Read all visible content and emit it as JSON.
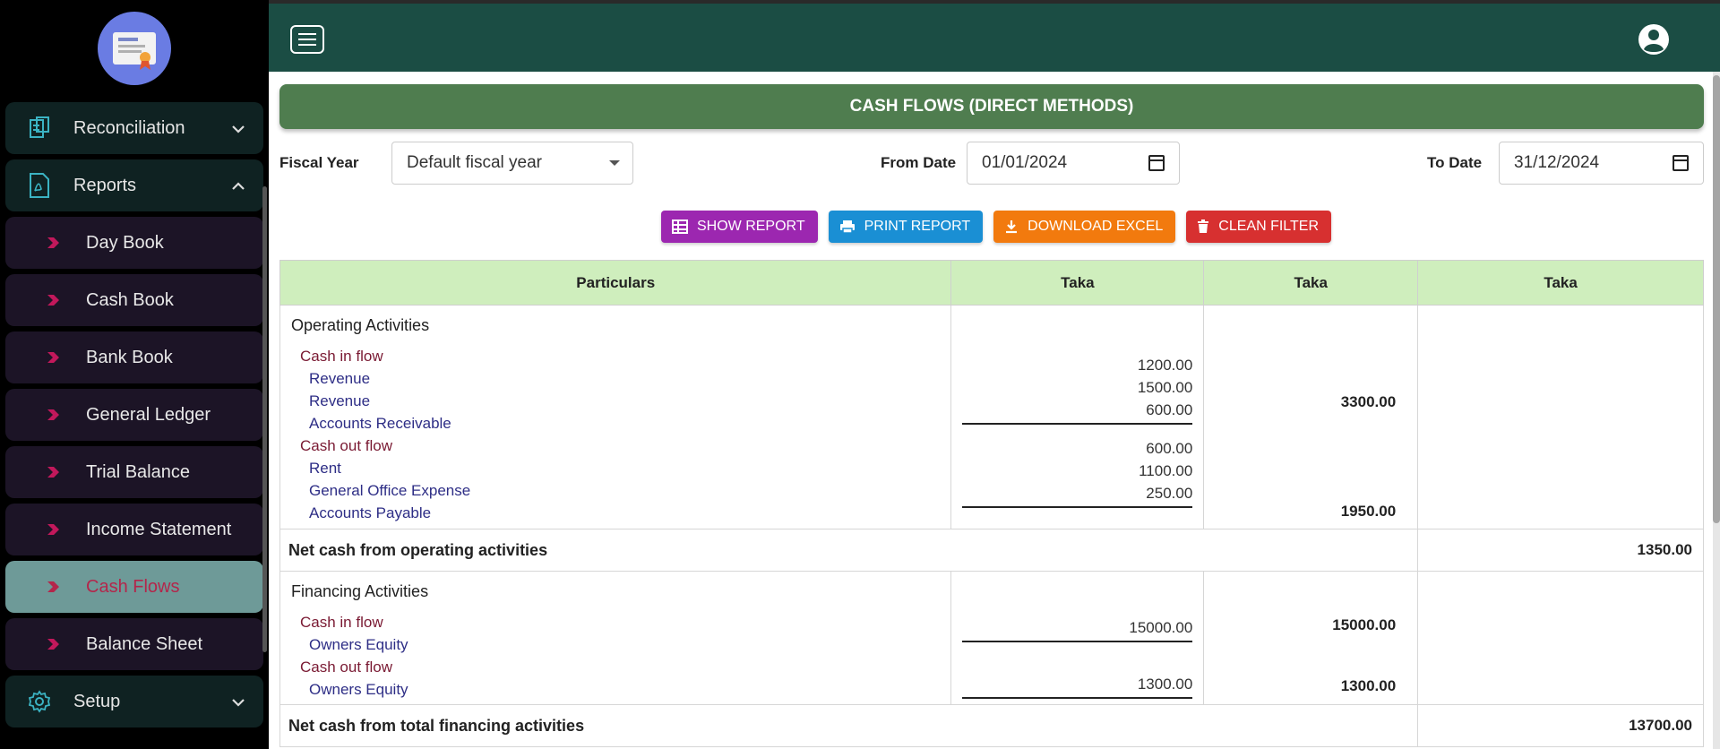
{
  "sidebar": {
    "groups": [
      {
        "label": "Reconciliation",
        "icon": "reconciliation-icon",
        "expanded": false
      },
      {
        "label": "Reports",
        "icon": "pdf-report-icon",
        "expanded": true
      },
      {
        "label": "Setup",
        "icon": "gear-icon",
        "expanded": false
      }
    ],
    "report_items": [
      {
        "label": "Day Book"
      },
      {
        "label": "Cash Book"
      },
      {
        "label": "Bank Book"
      },
      {
        "label": "General Ledger"
      },
      {
        "label": "Trial Balance"
      },
      {
        "label": "Income Statement"
      },
      {
        "label": "Cash Flows",
        "active": true
      },
      {
        "label": "Balance Sheet"
      }
    ]
  },
  "page": {
    "title": "CASH FLOWS (DIRECT METHODS)"
  },
  "filters": {
    "fiscal_year_label": "Fiscal Year",
    "fiscal_year_value": "Default fiscal year",
    "from_date_label": "From Date",
    "from_date_value": "01/01/2024",
    "to_date_label": "To Date",
    "to_date_value": "31/12/2024"
  },
  "buttons": {
    "show_report": "SHOW REPORT",
    "print_report": "PRINT REPORT",
    "download_excel": "DOWNLOAD EXCEL",
    "clean_filter": "CLEAN FILTER"
  },
  "table": {
    "headers": [
      "Particulars",
      "Taka",
      "Taka",
      "Taka"
    ],
    "operating": {
      "title": "Operating Activities",
      "inflow_label": "Cash in flow",
      "inflow": [
        {
          "name": "Revenue",
          "amount": "1200.00"
        },
        {
          "name": "Revenue",
          "amount": "1500.00"
        },
        {
          "name": "Accounts Receivable",
          "amount": "600.00"
        }
      ],
      "inflow_total": "3300.00",
      "outflow_label": "Cash out flow",
      "outflow": [
        {
          "name": "Rent",
          "amount": "600.00"
        },
        {
          "name": "General Office Expense",
          "amount": "1100.00"
        },
        {
          "name": "Accounts Payable",
          "amount": "250.00"
        }
      ],
      "outflow_total": "1950.00",
      "net_label": "Net cash from operating activities",
      "net_value": "1350.00"
    },
    "financing": {
      "title": "Financing Activities",
      "inflow_label": "Cash in flow",
      "inflow": [
        {
          "name": "Owners Equity",
          "amount": "15000.00"
        }
      ],
      "inflow_total": "15000.00",
      "outflow_label": "Cash out flow",
      "outflow": [
        {
          "name": "Owners Equity",
          "amount": "1300.00"
        }
      ],
      "outflow_total": "1300.00",
      "net_label": "Net cash from total financing activities",
      "net_value": "13700.00"
    }
  },
  "colors": {
    "topbar": "#1b4d44",
    "title_bar": "#4f7d4f",
    "header_row": "#cfeebd",
    "active_nav": "#6e9a98"
  }
}
